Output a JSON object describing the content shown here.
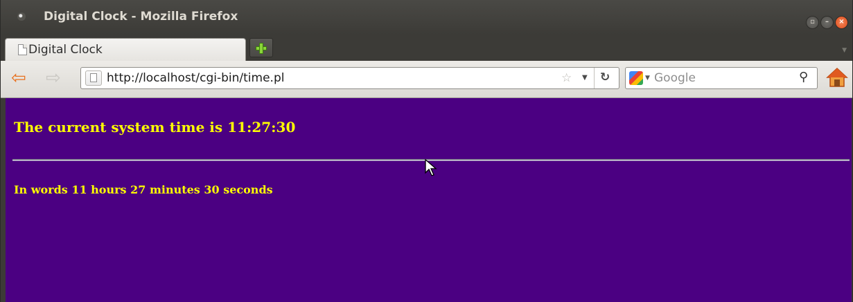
{
  "window": {
    "title": "Digital Clock - Mozilla Firefox"
  },
  "tabs": [
    {
      "label": "Digital Clock"
    }
  ],
  "navbar": {
    "url": "http://localhost/cgi-bin/time.pl",
    "search_placeholder": "Google"
  },
  "page": {
    "background_color": "#4b0082",
    "text_color": "#ffff00",
    "heading": "The current system time is 11:27:30",
    "subheading": "In words 11 hours 27 minutes 30 seconds"
  },
  "icons": {
    "back": "back-arrow-icon",
    "forward": "forward-arrow-icon",
    "bookmark": "star-icon",
    "reload": "reload-icon",
    "search": "magnifier-icon",
    "home": "home-icon",
    "new_tab": "plus-icon"
  }
}
